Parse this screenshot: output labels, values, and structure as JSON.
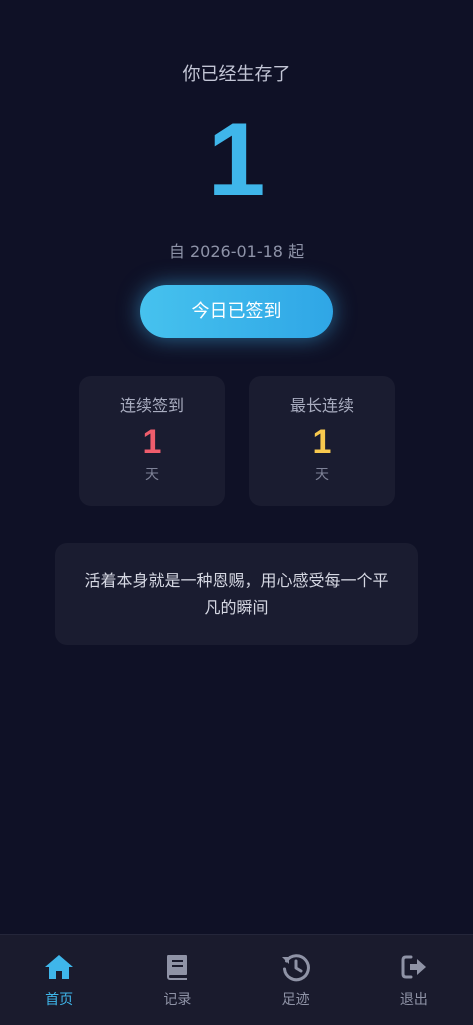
{
  "main": {
    "headline": "你已经生存了",
    "days_count": "1",
    "since_text": "自 2026-01-18 起",
    "checkin_button_label": "今日已签到"
  },
  "stats": {
    "streak": {
      "title": "连续签到",
      "value": "1",
      "unit": "天"
    },
    "longest": {
      "title": "最长连续",
      "value": "1",
      "unit": "天"
    }
  },
  "quote": {
    "text": "活着本身就是一种恩赐，用心感受每一个平凡的瞬间"
  },
  "tabbar": {
    "items": [
      {
        "label": "首页",
        "icon": "home-icon",
        "active": true
      },
      {
        "label": "记录",
        "icon": "book-icon",
        "active": false
      },
      {
        "label": "足迹",
        "icon": "history-icon",
        "active": false
      },
      {
        "label": "退出",
        "icon": "logout-icon",
        "active": false
      }
    ]
  },
  "colors": {
    "background": "#0f1126",
    "accent": "#3fb6ea",
    "streak_value": "#ef5d6c",
    "longest_value": "#f8c94e",
    "card": "#1a1c30"
  }
}
